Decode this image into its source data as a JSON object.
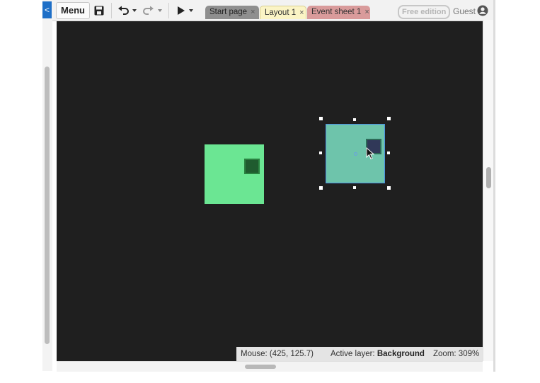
{
  "toolbar": {
    "collapse_glyph": "<",
    "menu_label": "Menu",
    "icons": [
      "save-icon",
      "undo-icon",
      "redo-icon",
      "play-icon"
    ]
  },
  "tabs": [
    {
      "label": "Start page",
      "close": "×",
      "color": "#8f8f8f"
    },
    {
      "label": "Layout 1",
      "close": "×",
      "color": "#fbf4c5"
    },
    {
      "label": "Event sheet 1",
      "close": "×",
      "color": "#d99b9b"
    }
  ],
  "account": {
    "edition_badge": "Free edition",
    "user_label": "Guest"
  },
  "canvas": {
    "background": "#1f1f1f",
    "sprites": [
      {
        "name": "green-square",
        "color": "#6be693",
        "selected": false
      },
      {
        "name": "teal-square",
        "color": "#6ec4ab",
        "selected": true
      }
    ]
  },
  "status": {
    "mouse_label": "Mouse:",
    "mouse_value": "(425, 125.7)",
    "layer_label": "Active layer:",
    "layer_value": "Background",
    "zoom_label": "Zoom:",
    "zoom_value": "309%"
  },
  "colors": {
    "accent": "#1e6fc7",
    "selection": "#4a90e2"
  }
}
